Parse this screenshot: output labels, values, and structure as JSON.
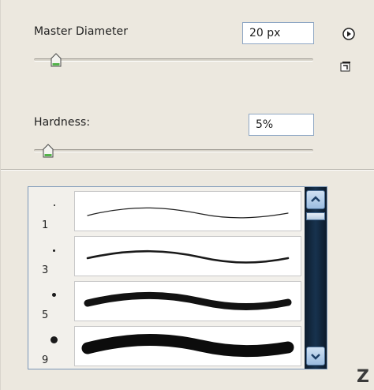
{
  "brush_panel": {
    "master_diameter": {
      "label": "Master Diameter",
      "value": "20 px",
      "level": 0.08
    },
    "hardness": {
      "label": "Hardness:",
      "value": "5%",
      "level": 0.05
    },
    "menu_icon": "play-circle-icon",
    "new_preset_icon": "new-preset-icon"
  },
  "presets": [
    {
      "size": "1"
    },
    {
      "size": "3"
    },
    {
      "size": "5"
    },
    {
      "size": "9"
    }
  ],
  "scrollbar": {
    "up_icon": "chevron-up-icon",
    "down_icon": "chevron-down-icon"
  },
  "corner_text": "Z"
}
